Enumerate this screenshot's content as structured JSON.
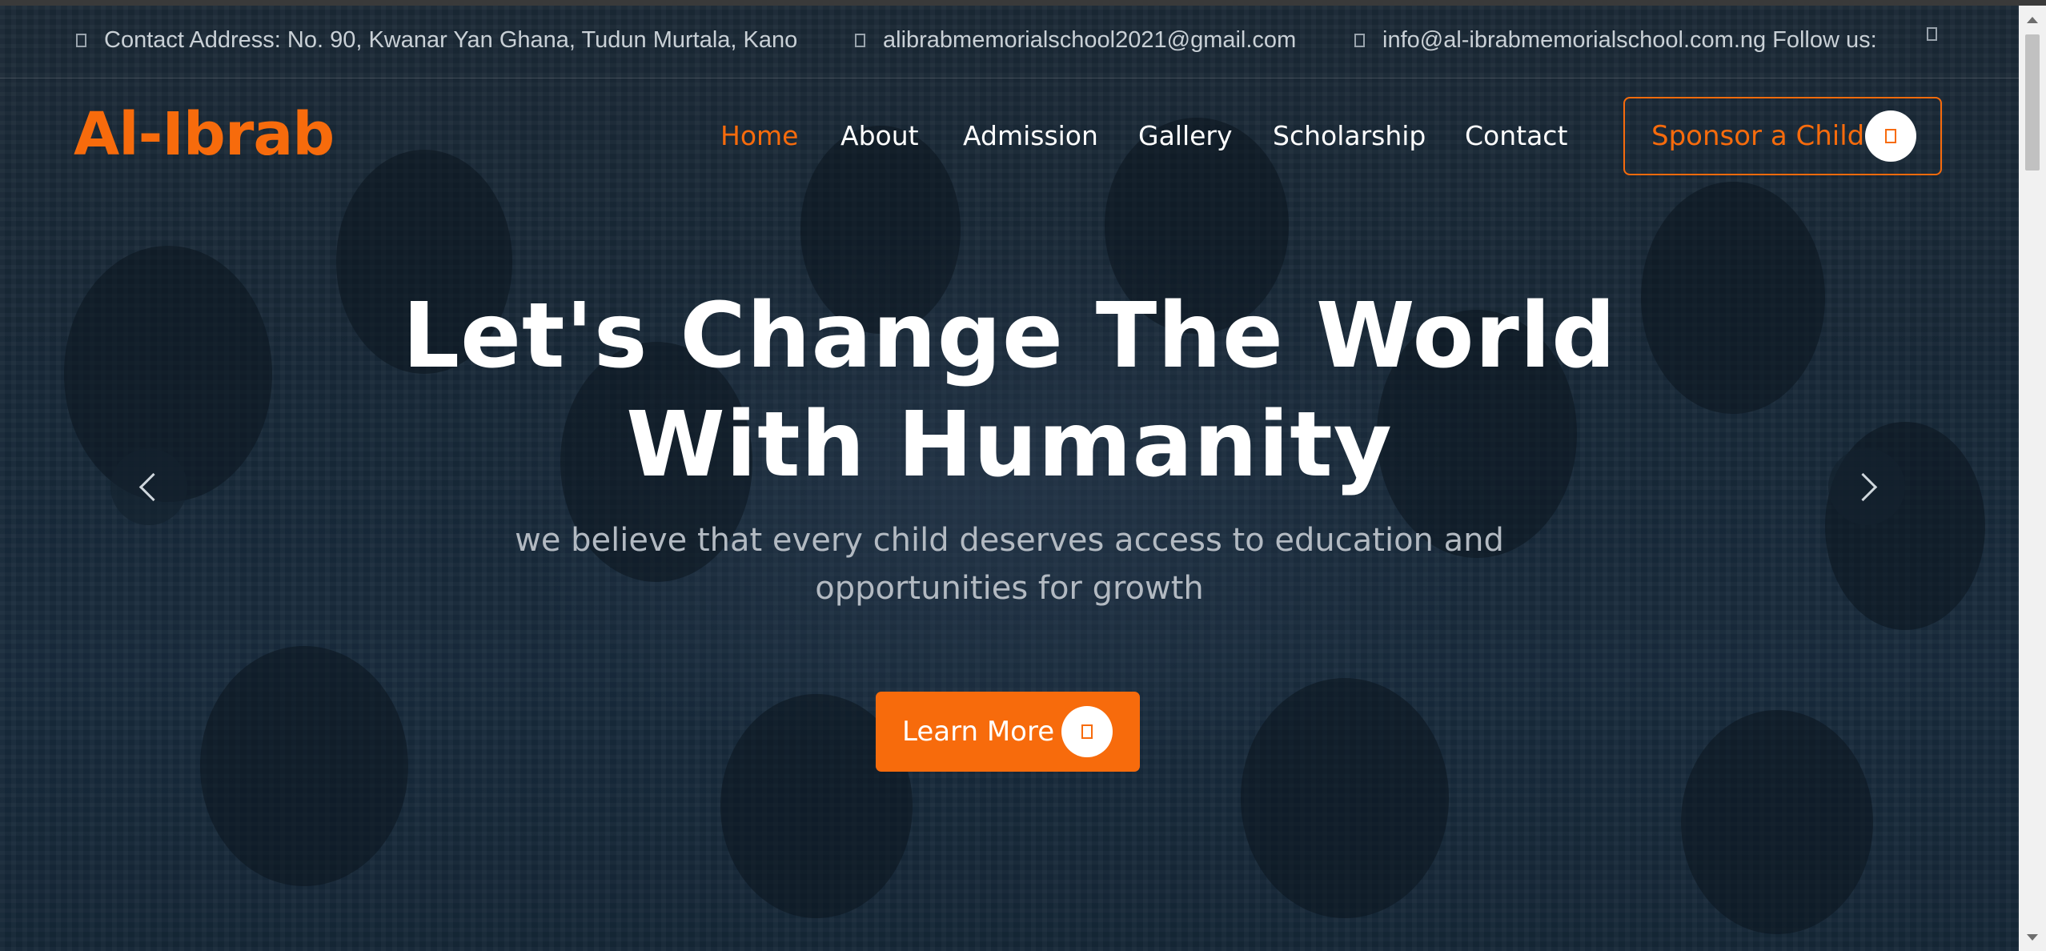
{
  "info_bar": {
    "address": "Contact Address: No. 90, Kwanar Yan Ghana, Tudun Murtala, Kano",
    "email_primary": "alibrabmemorialschool2021@gmail.com",
    "email_secondary": "info@al-ibrabmemorialschool.com.ng",
    "follow_label": "Follow us:",
    "icons": [
      "location-icon",
      "mail-icon",
      "mail-icon",
      "social-icon"
    ]
  },
  "header": {
    "logo": "Al-Ibrab",
    "nav": [
      {
        "label": "Home",
        "active": true
      },
      {
        "label": "About",
        "active": false
      },
      {
        "label": "Admission",
        "active": false
      },
      {
        "label": "Gallery",
        "active": false
      },
      {
        "label": "Scholarship",
        "active": false
      },
      {
        "label": "Contact",
        "active": false
      }
    ],
    "sponsor_label": "Sponsor a Child"
  },
  "hero": {
    "title_line1": "Let's Change The World",
    "title_line2": "With Humanity",
    "subtitle_line1": "we believe that every child deserves access to education and",
    "subtitle_line2": "opportunities for growth",
    "cta_label": "Learn More"
  },
  "colors": {
    "accent": "#f76b0c",
    "hero_overlay": "#1d3142",
    "text_light": "#ffffff",
    "text_muted": "#b3bac2"
  }
}
